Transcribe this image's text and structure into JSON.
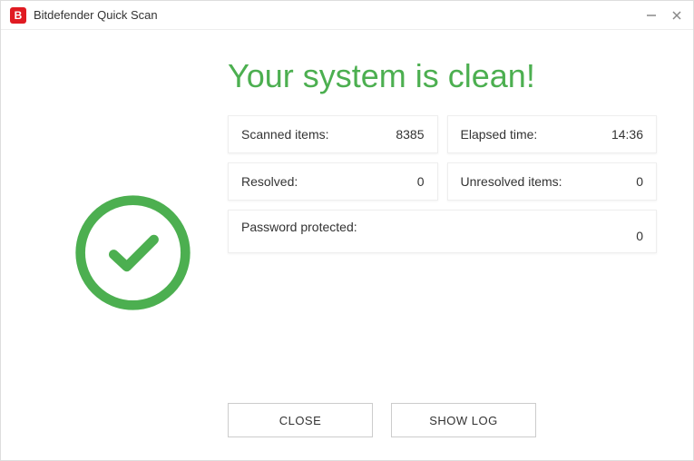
{
  "titlebar": {
    "icon_letter": "B",
    "title": "Bitdefender Quick Scan"
  },
  "result": {
    "headline": "Your system is clean!"
  },
  "stats": {
    "scanned_label": "Scanned items:",
    "scanned_value": "8385",
    "elapsed_label": "Elapsed time:",
    "elapsed_value": "14:36",
    "resolved_label": "Resolved:",
    "resolved_value": "0",
    "unresolved_label": "Unresolved items:",
    "unresolved_value": "0",
    "password_label": "Password protected:",
    "password_value": "0"
  },
  "buttons": {
    "close": "CLOSE",
    "showlog": "SHOW LOG"
  },
  "colors": {
    "success": "#4CAF50",
    "brand": "#e01b22"
  }
}
